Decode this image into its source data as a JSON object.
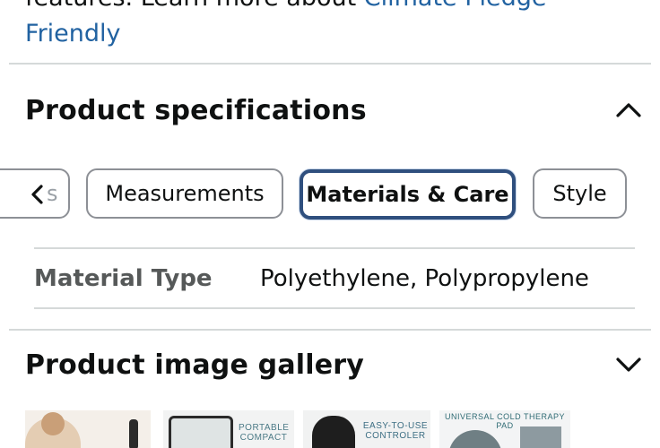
{
  "top_text": {
    "line1_plain": "features. Learn more about ",
    "line1_link": "Climate Pledge",
    "line2_link": "Friendly"
  },
  "specs": {
    "title": "Product specifications",
    "toggle_icon": "chevron-up-icon",
    "tabs": [
      {
        "label": "s",
        "state": "partial"
      },
      {
        "label": "Measurements",
        "state": "normal"
      },
      {
        "label": "Materials & Care",
        "state": "selected"
      },
      {
        "label": "Style",
        "state": "normal"
      }
    ],
    "rows": [
      {
        "key": "Material Type",
        "value": "Polyethylene, Polypropylene"
      }
    ]
  },
  "gallery": {
    "title": "Product image gallery",
    "toggle_icon": "chevron-down-icon",
    "thumbnails": [
      {
        "caption": ""
      },
      {
        "caption": "PORTABLE COMPACT"
      },
      {
        "caption": "EASY-TO-USE CONTROLER"
      },
      {
        "caption": "UNIVERSAL COLD THERAPY PAD"
      }
    ]
  },
  "colors": {
    "link": "#2162a1",
    "active_tab_border": "#2f4f7e",
    "divider": "#d5d9d9",
    "label_gray": "#565959"
  }
}
